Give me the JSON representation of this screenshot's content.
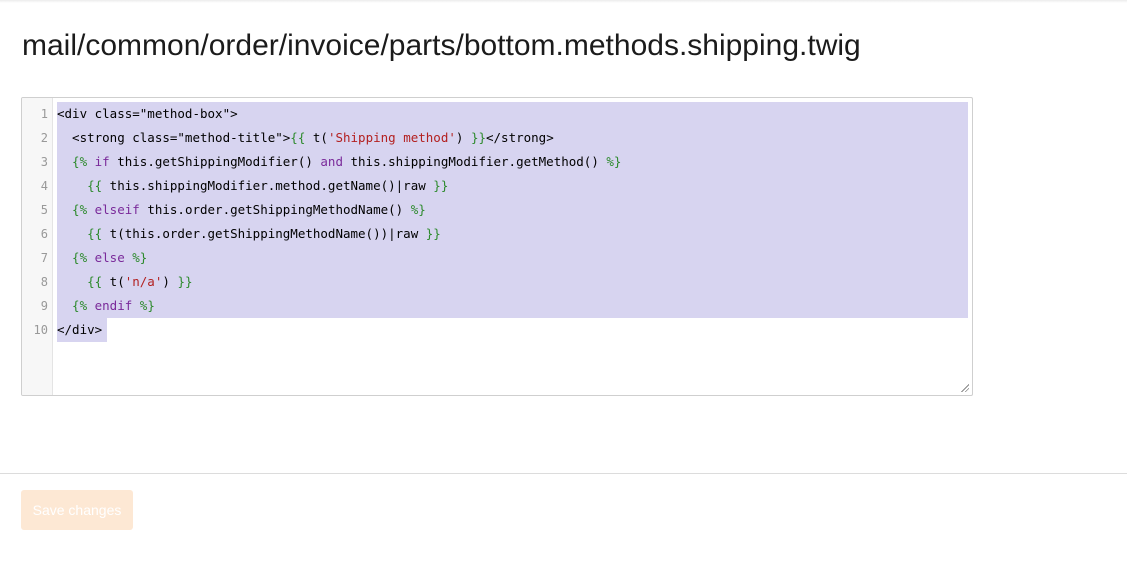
{
  "page": {
    "title": "mail/common/order/invoice/parts/bottom.methods.shipping.twig"
  },
  "editor": {
    "lines": [
      {
        "num": "1",
        "tokens": [
          {
            "t": "tag",
            "v": "<div class=\"method-box\">"
          }
        ]
      },
      {
        "num": "2",
        "tokens": [
          {
            "t": "tag",
            "v": "  <strong class=\"method-title\">"
          },
          {
            "t": "twig",
            "v": "{{"
          },
          {
            "t": "plain",
            "v": " t("
          },
          {
            "t": "str",
            "v": "'Shipping method'"
          },
          {
            "t": "plain",
            "v": ") "
          },
          {
            "t": "twig",
            "v": "}}"
          },
          {
            "t": "tag",
            "v": "</strong>"
          }
        ]
      },
      {
        "num": "3",
        "tokens": [
          {
            "t": "twig",
            "v": "  {%"
          },
          {
            "t": "kw",
            "v": " if"
          },
          {
            "t": "plain",
            "v": " this.getShippingModifier() "
          },
          {
            "t": "kw",
            "v": "and"
          },
          {
            "t": "plain",
            "v": " this.shippingModifier.getMethod() "
          },
          {
            "t": "twig",
            "v": "%}"
          }
        ]
      },
      {
        "num": "4",
        "tokens": [
          {
            "t": "twig",
            "v": "    {{"
          },
          {
            "t": "plain",
            "v": " this.shippingModifier.method.getName()|raw "
          },
          {
            "t": "twig",
            "v": "}}"
          }
        ]
      },
      {
        "num": "5",
        "tokens": [
          {
            "t": "twig",
            "v": "  {%"
          },
          {
            "t": "kw",
            "v": " elseif"
          },
          {
            "t": "plain",
            "v": " this.order.getShippingMethodName() "
          },
          {
            "t": "twig",
            "v": "%}"
          }
        ]
      },
      {
        "num": "6",
        "tokens": [
          {
            "t": "twig",
            "v": "    {{"
          },
          {
            "t": "plain",
            "v": " t(this.order.getShippingMethodName())|raw "
          },
          {
            "t": "twig",
            "v": "}}"
          }
        ]
      },
      {
        "num": "7",
        "tokens": [
          {
            "t": "twig",
            "v": "  {%"
          },
          {
            "t": "kw",
            "v": " else"
          },
          {
            "t": "twig",
            "v": " %}"
          }
        ]
      },
      {
        "num": "8",
        "tokens": [
          {
            "t": "twig",
            "v": "    {{"
          },
          {
            "t": "plain",
            "v": " t("
          },
          {
            "t": "str",
            "v": "'n/a'"
          },
          {
            "t": "plain",
            "v": ") "
          },
          {
            "t": "twig",
            "v": "}}"
          }
        ]
      },
      {
        "num": "9",
        "tokens": [
          {
            "t": "twig",
            "v": "  {%"
          },
          {
            "t": "kw",
            "v": " endif"
          },
          {
            "t": "twig",
            "v": " %}"
          }
        ]
      },
      {
        "num": "10",
        "tokens": [
          {
            "t": "tag",
            "v": "</div>"
          }
        ]
      }
    ],
    "selected": true
  },
  "footer": {
    "save_label": "Save changes"
  },
  "colors": {
    "selection": "#d7d4f0",
    "twig_delimiter": "#2d8a2d",
    "keyword": "#7a2a9a",
    "string": "#b32020",
    "save_button_bg": "#fde8d4"
  }
}
